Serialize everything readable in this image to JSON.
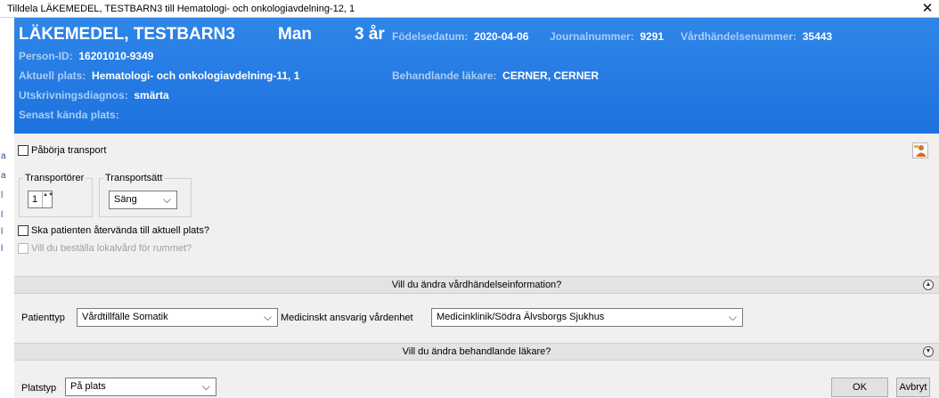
{
  "window": {
    "title": "Tilldela LÄKEMEDEL, TESTBARN3 till Hematologi- och onkologiavdelning-12, 1",
    "close_glyph": "✕"
  },
  "left_fragments": [
    "a",
    "a",
    "l",
    "l",
    "l",
    "l"
  ],
  "banner": {
    "name": "LÄKEMEDEL, TESTBARN3",
    "sex": "Man",
    "age": "3 år",
    "birthdate_label": "Födelsedatum:",
    "birthdate": "2020-04-06",
    "journal_label": "Journalnummer:",
    "journal": "9291",
    "event_label": "Vårdhändelsenummer:",
    "event": "35443",
    "person_id_label": "Person-ID:",
    "person_id": "16201010-9349",
    "current_place_label": "Aktuell plats:",
    "current_place": "Hematologi- och onkologiavdelning-11, 1",
    "physician_label": "Behandlande läkare:",
    "physician": "CERNER, CERNER",
    "diagnosis_label": "Utskrivningsdiagnos:",
    "diagnosis": "smärta",
    "last_place_label": "Senast kända plats:",
    "background_color": "#1d72de"
  },
  "transport": {
    "start_label": "Påbörja transport",
    "transporters_label": "Transportörer",
    "transporters_value": "1",
    "mode_label": "Transportsätt",
    "mode_value": "Säng",
    "return_label": "Ska patienten återvända till aktuell plats?",
    "cleaning_label": "Vill du beställa lokalvård för rummet?"
  },
  "sections": {
    "event_info": "Vill du ändra vårdhändelseinformation?",
    "physician_change": "Vill du ändra behandlande läkare?"
  },
  "event_fields": {
    "patient_type_label": "Patienttyp",
    "patient_type": "Vårdtillfälle Somatik",
    "unit_label": "Medicinskt ansvarig vårdenhet",
    "unit": "Medicinklinik/Södra Älvsborgs Sjukhus"
  },
  "footer": {
    "place_type_label": "Platstyp",
    "place_type": "På plats",
    "ok_label": "OK",
    "cancel_label": "Avbryt"
  },
  "icons": {
    "dropdown": "⌵",
    "collapse": "▲",
    "expand": "▼",
    "spin": "▲▼"
  }
}
